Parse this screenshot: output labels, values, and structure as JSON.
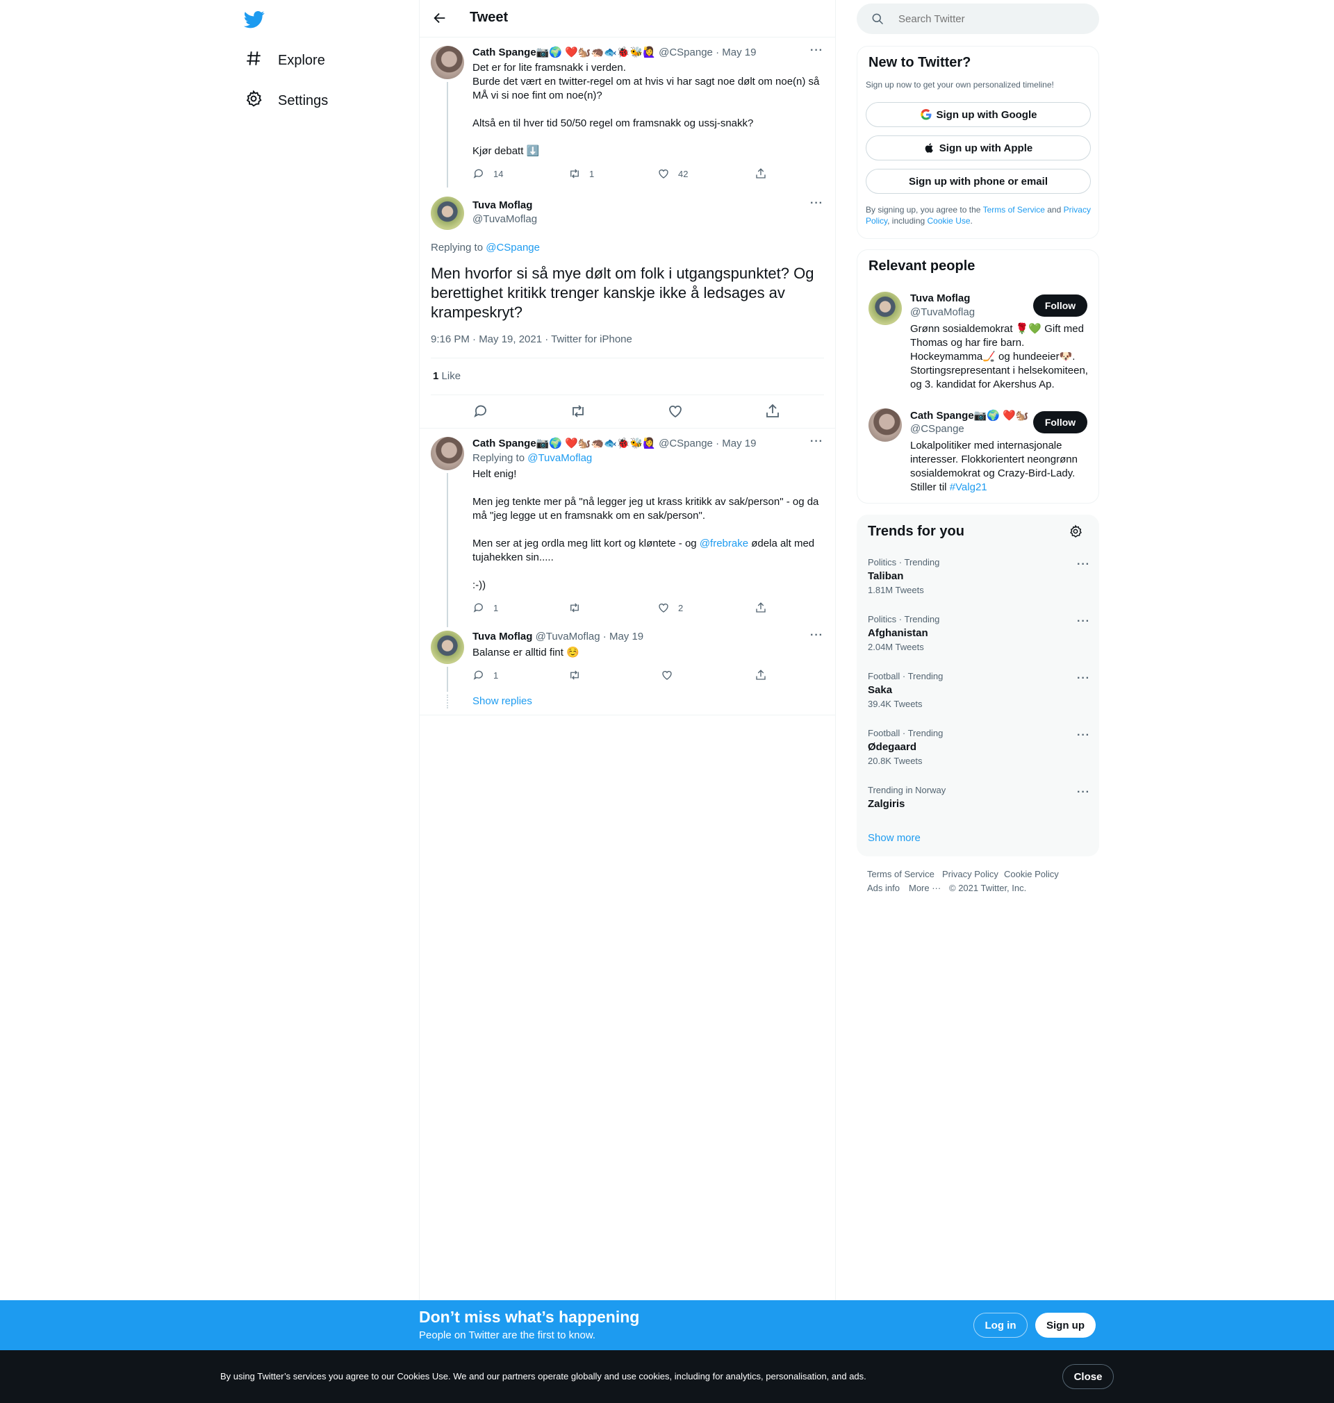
{
  "nav": {
    "items": [
      {
        "label": "Explore",
        "icon": "hashtag-icon"
      },
      {
        "label": "Settings",
        "icon": "gear-icon"
      }
    ]
  },
  "header": {
    "title": "Tweet"
  },
  "tweet1": {
    "name": "Cath Spange📷🌍 ❤️🐿️🦔🐟🐞🐝🙋‍♀️",
    "handle": "@CSpange",
    "date": "· May 19",
    "text": "Det er for lite framsnakk i verden.\nBurde det vært en twitter-regel om at hvis vi har sagt noe dølt om noe(n) så MÅ vi si noe fint om noe(n)?\n\nAltså en til hver tid 50/50 regel om framsnakk og ussj-snakk?\n\nKjør debatt ⬇️",
    "replies": "14",
    "retweets": "1",
    "likes": "42"
  },
  "main": {
    "name": "Tuva Moflag",
    "handle": "@TuvaMoflag",
    "replying_prefix": "Replying to",
    "replying_to": "@CSpange",
    "text": "Men hvorfor si så mye dølt om folk i utgangspunktet? Og berettighet kritikk trenger kanskje ikke å ledsages av krampeskryt?",
    "timestamp": "9:16 PM · May 19, 2021 · Twitter for iPhone",
    "like_count": "1",
    "like_label": "Like"
  },
  "reply1": {
    "name": "Cath Spange📷🌍 ❤️🐿️🦔🐟🐞🐝🙋‍♀️",
    "handle": "@CSpange",
    "date": "· May 19",
    "replying_prefix": "Replying to",
    "replying_to": "@TuvaMoflag",
    "text_a": "Helt enig!\n\nMen jeg tenkte mer på \"nå legger jeg ut krass kritikk av sak/person\" - og da må \"jeg legge ut en framsnakk om en sak/person\".\n\nMen ser at jeg ordla meg litt kort og kløntete - og ",
    "mention": "@frebrake",
    "text_b": " ødela alt med tujahekken sin.....\n\n:-))",
    "replies": "1",
    "likes": "2"
  },
  "reply2": {
    "name": "Tuva Moflag",
    "handle": "@TuvaMoflag",
    "date": "· May 19",
    "text": "Balanse er alltid fint ☺️",
    "replies": "1",
    "show_replies": "Show replies"
  },
  "search": {
    "placeholder": "Search Twitter"
  },
  "new_to_twitter": {
    "title": "New to Twitter?",
    "subtitle": "Sign up now to get your own personalized timeline!",
    "google": "Sign up with Google",
    "apple": "Sign up with Apple",
    "phone": "Sign up with phone or email",
    "legal_a": "By signing up, you agree to the ",
    "terms": "Terms of Service",
    "legal_b": " and ",
    "privacy": "Privacy Policy",
    "legal_c": ", including ",
    "cookie": "Cookie Use",
    "legal_d": "."
  },
  "relevant": {
    "title": "Relevant people",
    "people": [
      {
        "name": "Tuva Moflag",
        "handle": "@TuvaMoflag",
        "follow": "Follow",
        "bio": "Grønn sosialdemokrat 🌹💚 Gift med Thomas og har fire barn. Hockeymamma🏒 og hundeeier🐶. Stortingsrepresentant i helsekomiteen, og 3. kandidat for Akershus Ap."
      },
      {
        "name": "Cath Spange📷🌍 ❤️🐿️",
        "handle": "@CSpange",
        "follow": "Follow",
        "bio": "Lokalpolitiker med internasjonale interesser. Flokkorientert neongrønn sosialdemokrat og Crazy-Bird-Lady. Stiller til ",
        "hashtag": "#Valg21"
      }
    ]
  },
  "trends": {
    "title": "Trends for you",
    "items": [
      {
        "category": "Politics · Trending",
        "name": "Taliban",
        "count": "1.81M Tweets"
      },
      {
        "category": "Politics · Trending",
        "name": "Afghanistan",
        "count": "2.04M Tweets"
      },
      {
        "category": "Football · Trending",
        "name": "Saka",
        "count": "39.4K Tweets"
      },
      {
        "category": "Football · Trending",
        "name": "Ødegaard",
        "count": "20.8K Tweets"
      },
      {
        "category": "Trending in Norway",
        "name": "Zalgiris",
        "count": ""
      }
    ],
    "show_more": "Show more"
  },
  "footer": {
    "terms": "Terms of Service",
    "privacy": "Privacy Policy",
    "cookie": "Cookie Policy",
    "ads": "Ads info",
    "more": "More ···",
    "copyright": "© 2021 Twitter, Inc."
  },
  "banner": {
    "title": "Don’t miss what’s happening",
    "subtitle": "People on Twitter are the first to know.",
    "login": "Log in",
    "signup": "Sign up"
  },
  "cookie_bar": {
    "text": "By using Twitter’s services you agree to our Cookies Use. We and our partners operate globally and use cookies, including for analytics, personalisation, and ads.",
    "close": "Close"
  },
  "colors": {
    "accent": "#1d9bf0",
    "text": "#0f1419",
    "secondary": "#536471",
    "border": "#eff3f4"
  }
}
